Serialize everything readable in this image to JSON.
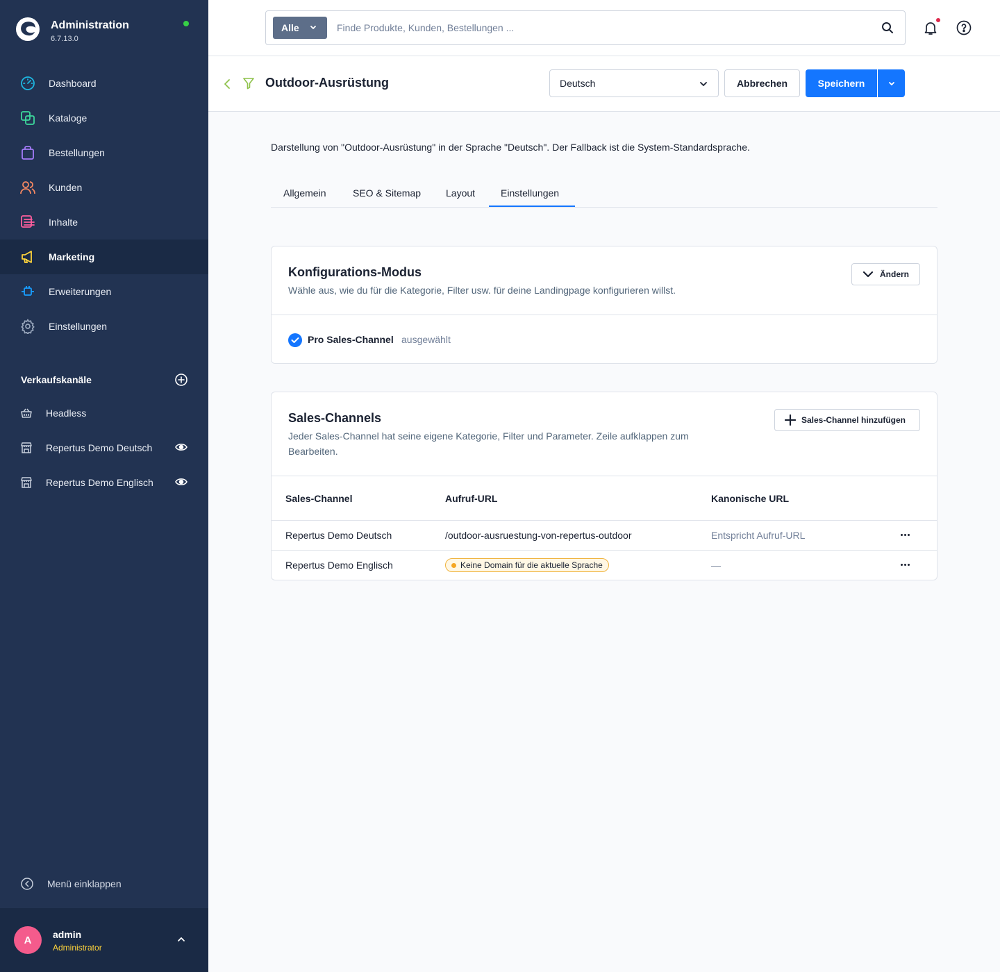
{
  "app": {
    "title": "Administration",
    "version": "6.7.13.0",
    "status_color": "#37d046"
  },
  "sidebar": {
    "items": [
      {
        "label": "Dashboard",
        "icon": "dashboard-icon",
        "color": "#1eb6e0"
      },
      {
        "label": "Kataloge",
        "icon": "catalogue-icon",
        "color": "#3dd89c"
      },
      {
        "label": "Bestellungen",
        "icon": "orders-icon",
        "color": "#a47cf8"
      },
      {
        "label": "Kunden",
        "icon": "customers-icon",
        "color": "#f88962"
      },
      {
        "label": "Inhalte",
        "icon": "content-icon",
        "color": "#ff5f9e"
      },
      {
        "label": "Marketing",
        "icon": "megaphone-icon",
        "color": "#ffd43b",
        "active": true
      },
      {
        "label": "Erweiterungen",
        "icon": "plugin-icon",
        "color": "#189eff"
      },
      {
        "label": "Einstellungen",
        "icon": "gear-icon",
        "color": "#9aa8bd"
      }
    ],
    "sales_channels_title": "Verkaufskanäle",
    "sales_channels": [
      {
        "label": "Headless",
        "icon": "basket-icon"
      },
      {
        "label": "Repertus Demo Deutsch",
        "icon": "storefront-icon",
        "visible_toggle": true
      },
      {
        "label": "Repertus Demo Englisch",
        "icon": "storefront-icon",
        "visible_toggle": true
      }
    ],
    "collapse_label": "Menü einklappen"
  },
  "user": {
    "initial": "A",
    "name": "admin",
    "role": "Administrator"
  },
  "topbar": {
    "search_type": "Alle",
    "search_placeholder": "Finde Produkte, Kunden, Bestellungen ..."
  },
  "smartbar": {
    "title": "Outdoor-Ausrüstung",
    "language": "Deutsch",
    "cancel_label": "Abbrechen",
    "save_label": "Speichern"
  },
  "main": {
    "info": "Darstellung von \"Outdoor-Ausrüstung\" in der Sprache \"Deutsch\". Der Fallback ist die System-Standardsprache.",
    "tabs": [
      {
        "label": "Allgemein"
      },
      {
        "label": "SEO & Sitemap"
      },
      {
        "label": "Layout"
      },
      {
        "label": "Einstellungen",
        "active": true
      }
    ],
    "config_card": {
      "title": "Konfigurations-Modus",
      "subtitle": "Wähle aus, wie du für die Kategorie, Filter usw. für deine Landingpage konfigurieren willst.",
      "change_label": "Ändern",
      "selected_mode": "Pro Sales-Channel",
      "selected_suffix": "ausgewählt"
    },
    "channels_card": {
      "title": "Sales-Channels",
      "subtitle_line1": "Jeder Sales-Channel hat seine eigene Kategorie, Filter und Parameter. Zeile aufklappen zum",
      "subtitle_line2": "Bearbeiten.",
      "add_label": "Sales-Channel hinzufügen",
      "columns": [
        "Sales-Channel",
        "Aufruf-URL",
        "Kanonische URL"
      ],
      "rows": [
        {
          "channel": "Repertus Demo Deutsch",
          "url": "/outdoor-ausruestung-von-repertus-outdoor",
          "canonical": "Entspricht Aufruf-URL"
        },
        {
          "channel": "Repertus Demo Englisch",
          "url_badge": "Keine Domain für die aktuelle Sprache",
          "canonical": "—"
        }
      ]
    }
  }
}
